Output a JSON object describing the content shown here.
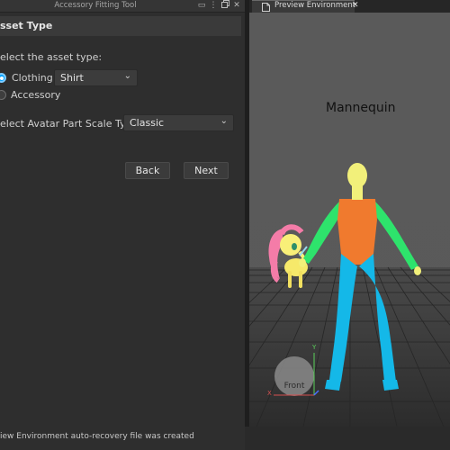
{
  "tool_window": {
    "title": "Accessory Fitting Tool",
    "section_title": "sset Type",
    "asset_type_prompt": "elect the asset type:",
    "options": {
      "clothing": {
        "label": "Clothing",
        "selected": true
      },
      "accessory": {
        "label": "Accessory",
        "selected": false
      }
    },
    "clothing_type": {
      "value": "Shirt"
    },
    "scale_type": {
      "label": "elect Avatar Part Scale Type:",
      "value": "Classic"
    },
    "back_label": "Back",
    "next_label": "Next"
  },
  "preview": {
    "tab_label": "Preview Environment",
    "model_label": "Mannequin",
    "view_cube_label": "Front",
    "axis_labels": {
      "x": "X",
      "y": "Y"
    }
  },
  "status_message": "iew Environment auto-recovery file was created",
  "icons": {
    "title_bar": [
      "dock-icon",
      "pin-icon",
      "restore-icon",
      "close-icon"
    ],
    "tab": "document-icon"
  },
  "colors": {
    "accent": "#00a2ff",
    "panel_bg": "#2e2e2e",
    "viewport_bg": "#5b5b5b",
    "mannequin_head": "#f2f07a",
    "mannequin_arms": "#2ee36c",
    "mannequin_torso": "#f07a2e",
    "mannequin_legs": "#14b8e8"
  }
}
